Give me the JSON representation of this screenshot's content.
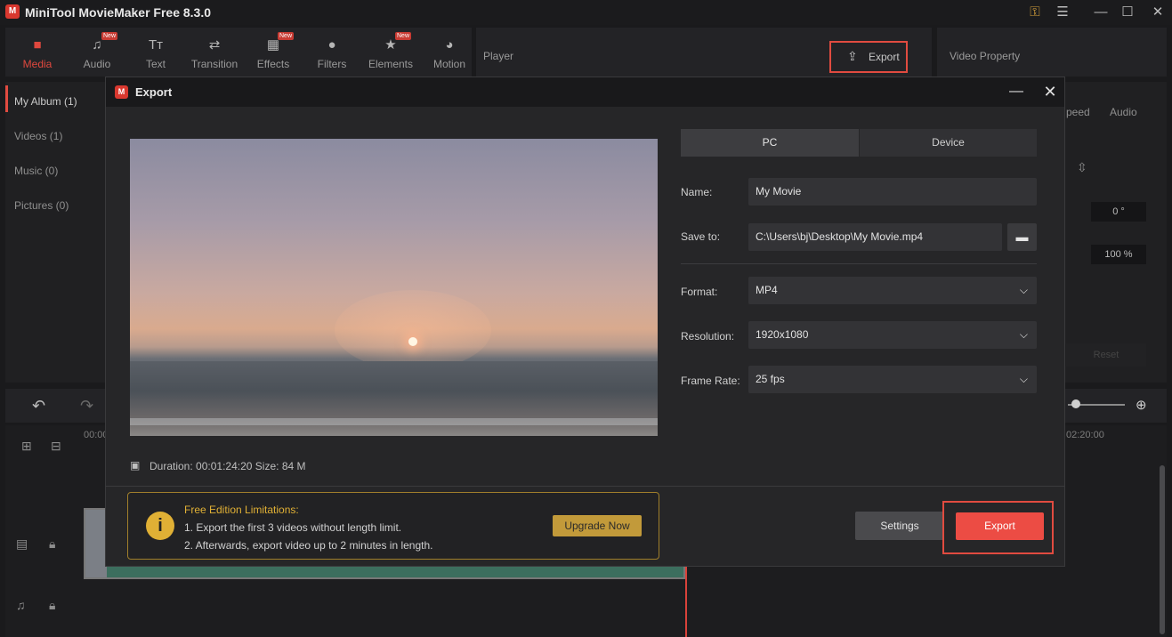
{
  "app": {
    "title": "MiniTool MovieMaker Free 8.3.0",
    "logo_text": "M",
    "window_controls": [
      "key-icon",
      "menu-icon",
      "minimize-icon",
      "maximize-icon",
      "close-icon"
    ]
  },
  "toolbar": {
    "tabs": [
      {
        "label": "Media",
        "icon": "media-icon",
        "active": true,
        "new": false
      },
      {
        "label": "Audio",
        "icon": "audio-icon",
        "active": false,
        "new": true
      },
      {
        "label": "Text",
        "icon": "text-icon",
        "active": false,
        "new": false
      },
      {
        "label": "Transition",
        "icon": "transition-icon",
        "active": false,
        "new": false
      },
      {
        "label": "Effects",
        "icon": "effects-icon",
        "active": false,
        "new": true
      },
      {
        "label": "Filters",
        "icon": "filters-icon",
        "active": false,
        "new": false
      },
      {
        "label": "Elements",
        "icon": "elements-icon",
        "active": false,
        "new": true
      },
      {
        "label": "Motion",
        "icon": "motion-icon",
        "active": false,
        "new": false
      }
    ],
    "new_badge": "New"
  },
  "player": {
    "label": "Player",
    "export_label": "Export"
  },
  "video_property": {
    "label": "Video Property",
    "tabs": [
      "peed",
      "Audio"
    ],
    "rotation": "0 °",
    "scale": "100 %",
    "reset_label": "Reset"
  },
  "album": {
    "items": [
      "My Album (1)",
      "Videos (1)",
      "Music (0)",
      "Pictures (0)"
    ]
  },
  "timeline": {
    "start_time": "00:00",
    "end_time": "02:20:00"
  },
  "dialog": {
    "title": "Export",
    "tabs": {
      "pc": "PC",
      "device": "Device"
    },
    "fields": {
      "name_label": "Name:",
      "name_value": "My Movie",
      "save_label": "Save to:",
      "save_value": "C:\\Users\\bj\\Desktop\\My Movie.mp4",
      "format_label": "Format:",
      "format_value": "MP4",
      "resolution_label": "Resolution:",
      "resolution_value": "1920x1080",
      "framerate_label": "Frame Rate:",
      "framerate_value": "25 fps"
    },
    "info": {
      "duration_label": "Duration:",
      "duration_value": "00:01:24:20",
      "size_label": "Size:",
      "size_value": "84 M"
    },
    "limitations": {
      "title": "Free Edition Limitations:",
      "line1": "1. Export the first 3 videos without length limit.",
      "line2": "2. Afterwards, export video up to 2 minutes in length.",
      "upgrade_label": "Upgrade Now"
    },
    "settings_label": "Settings",
    "export_label": "Export"
  },
  "colors": {
    "accent": "#e14b40",
    "export_button": "#ec4c44",
    "gold": "#e0b035",
    "background": "#1a1a1c"
  }
}
